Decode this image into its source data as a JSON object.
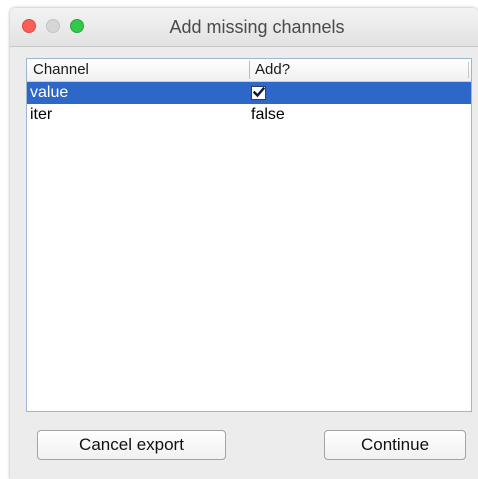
{
  "window": {
    "title": "Add missing channels"
  },
  "table": {
    "columns": [
      "Channel",
      "Add?"
    ],
    "rows": [
      {
        "channel": "value",
        "add": true,
        "add_display": "",
        "selected": true
      },
      {
        "channel": "iter",
        "add": false,
        "add_display": "false",
        "selected": false
      }
    ]
  },
  "buttons": {
    "cancel_label": "Cancel export",
    "continue_label": "Continue"
  },
  "colors": {
    "selection": "#2d68c9",
    "close_light": "#fc5e57",
    "minimize_light": "#d6d6d6",
    "zoom_light": "#34c84a"
  },
  "icons": {
    "checkbox_checked": "checkmark-icon"
  }
}
